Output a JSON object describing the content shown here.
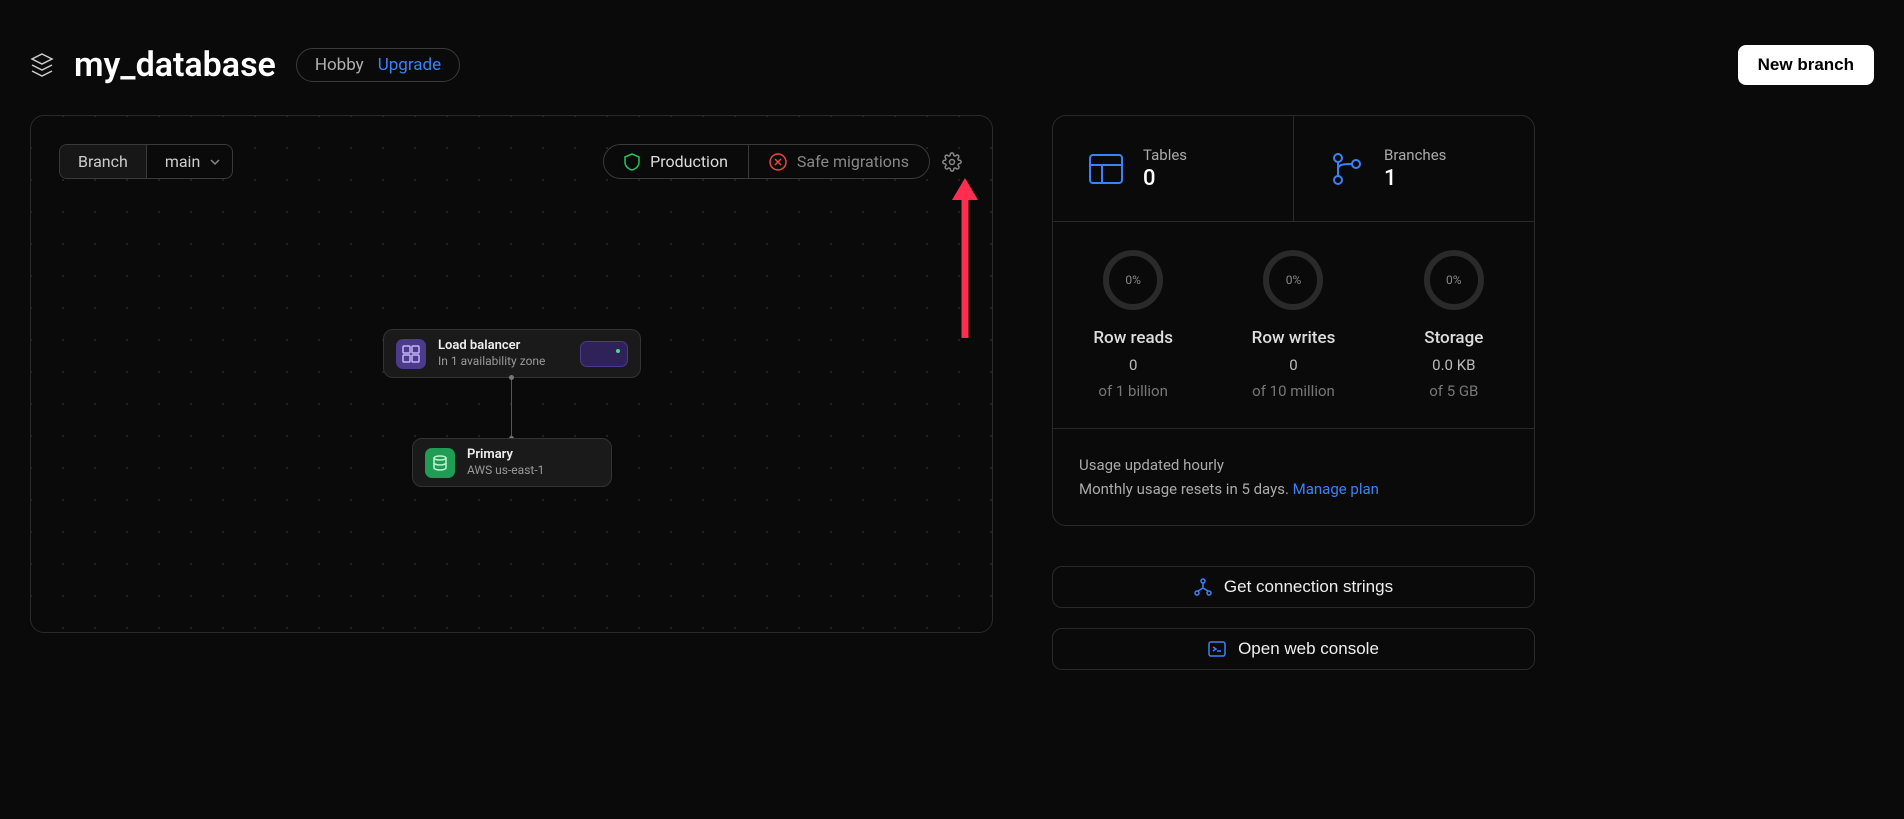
{
  "header": {
    "title": "my_database",
    "plan_label": "Hobby",
    "upgrade_label": "Upgrade",
    "new_branch_label": "New branch"
  },
  "canvas": {
    "branch_label": "Branch",
    "branch_value": "main",
    "status_production": "Production",
    "status_migrations": "Safe migrations",
    "lb": {
      "title": "Load balancer",
      "subtitle": "In 1 availability zone"
    },
    "primary": {
      "title": "Primary",
      "subtitle": "AWS us-east-1"
    }
  },
  "stats": {
    "tables": {
      "label": "Tables",
      "value": "0"
    },
    "branches": {
      "label": "Branches",
      "value": "1"
    },
    "gauges": [
      {
        "pct": "0%",
        "label": "Row reads",
        "value": "0",
        "limit": "of 1 billion"
      },
      {
        "pct": "0%",
        "label": "Row writes",
        "value": "0",
        "limit": "of 10 million"
      },
      {
        "pct": "0%",
        "label": "Storage",
        "value": "0.0 KB",
        "limit": "of 5 GB"
      }
    ],
    "usage_line1": "Usage updated hourly",
    "usage_line2_prefix": "Monthly usage resets in 5 days. ",
    "manage_plan": "Manage plan"
  },
  "actions": {
    "conn": "Get connection strings",
    "console": "Open web console"
  }
}
